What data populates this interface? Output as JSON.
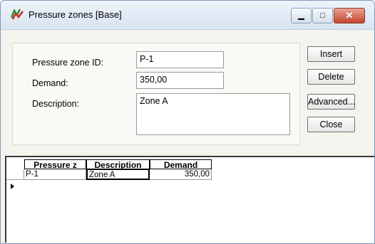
{
  "window": {
    "title": "Pressure zones [Base]",
    "minimize_glyph": "▁",
    "maximize_glyph": "□",
    "close_glyph": "✕"
  },
  "form": {
    "zone_id": {
      "label": "Pressure zone ID:",
      "value": "P-1"
    },
    "demand": {
      "label": "Demand:",
      "value": "350,00"
    },
    "description": {
      "label": "Description:",
      "value": "Zone A"
    }
  },
  "buttons": {
    "insert": "Insert",
    "delete": "Delete",
    "advanced": "Advanced...",
    "close": "Close"
  },
  "grid": {
    "columns": [
      "Pressure z",
      "Description",
      "Demand"
    ],
    "rows": [
      {
        "zone": "P-1",
        "description": "Zone A",
        "demand": "350,00"
      }
    ]
  }
}
